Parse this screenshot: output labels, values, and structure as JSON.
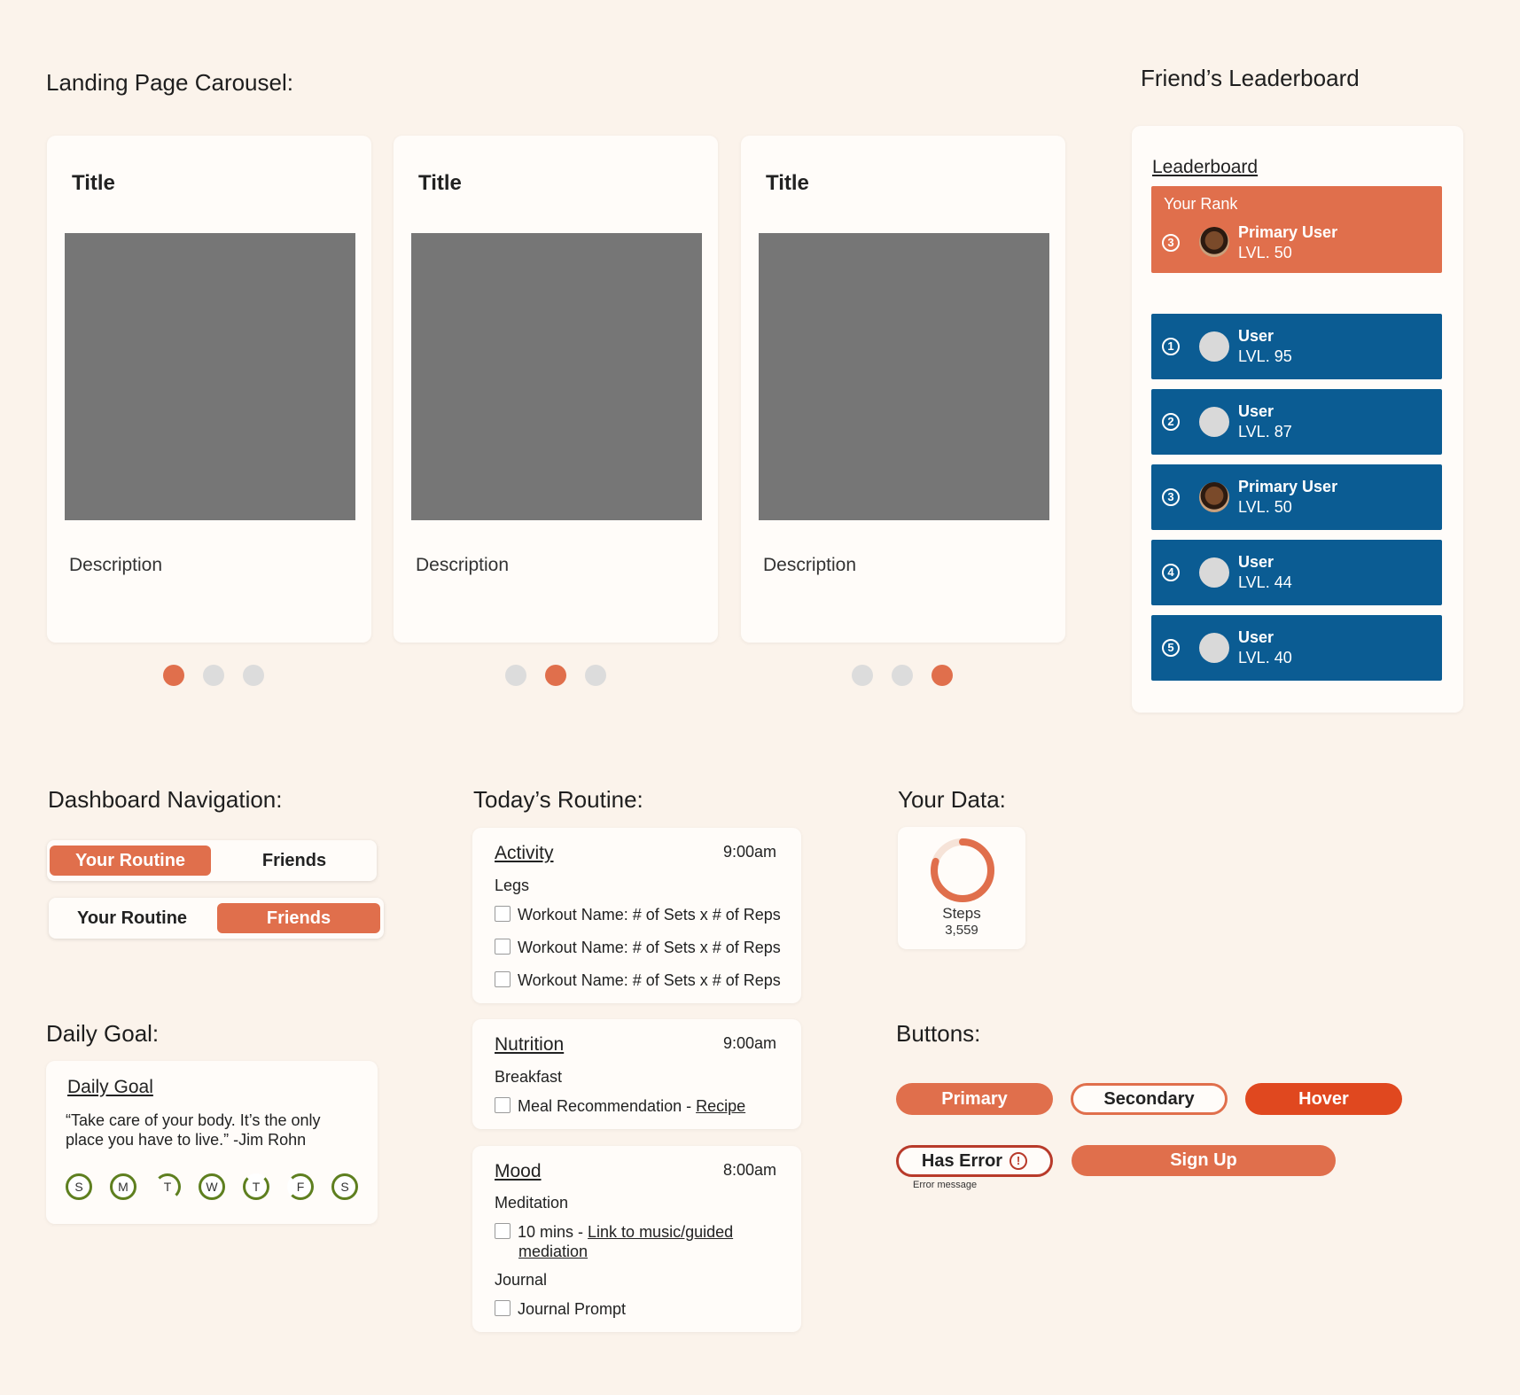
{
  "carousel": {
    "section_title": "Landing Page Carousel:",
    "cards": [
      {
        "title": "Title",
        "description": "Description"
      },
      {
        "title": "Title",
        "description": "Description"
      },
      {
        "title": "Title",
        "description": "Description"
      }
    ]
  },
  "leaderboard": {
    "section_title": "Friend’s Leaderboard",
    "heading": "Leaderboard",
    "your_rank": {
      "label": "Your Rank",
      "rank": "3",
      "name": "Primary User",
      "level": "LVL. 50"
    },
    "rows": [
      {
        "rank": "1",
        "name": "User",
        "level": "LVL. 95"
      },
      {
        "rank": "2",
        "name": "User",
        "level": "LVL. 87"
      },
      {
        "rank": "3",
        "name": "Primary User",
        "level": "LVL. 50"
      },
      {
        "rank": "4",
        "name": "User",
        "level": "LVL. 44"
      },
      {
        "rank": "5",
        "name": "User",
        "level": "LVL. 40"
      }
    ]
  },
  "dashboard_nav": {
    "section_title": "Dashboard Navigation:",
    "tab_routine": "Your Routine",
    "tab_friends": "Friends"
  },
  "routine": {
    "section_title": "Today’s Routine:",
    "activity": {
      "title": "Activity",
      "time": "9:00am",
      "group": "Legs",
      "items": [
        "Workout Name: # of Sets x # of Reps",
        "Workout Name: # of Sets x # of Reps",
        "Workout Name: # of Sets x # of Reps"
      ]
    },
    "nutrition": {
      "title": "Nutrition",
      "time": "9:00am",
      "group": "Breakfast",
      "item": "Meal Recommendation - ",
      "link": "Recipe"
    },
    "mood": {
      "title": "Mood",
      "time": "8:00am",
      "group1": "Meditation",
      "item1": "10 mins - ",
      "link1a": "Link to music/guided",
      "link1b": "mediation",
      "group2": "Journal",
      "item2": "Journal Prompt"
    }
  },
  "your_data": {
    "section_title": "Your Data:",
    "label": "Steps",
    "value": "3,559",
    "progress": 0.8,
    "accent": "#E06F4C"
  },
  "daily_goal": {
    "section_title": "Daily Goal:",
    "heading": "Daily Goal",
    "quote_line1": "“Take care of your body. It’s the only",
    "quote_line2": "place you have to live.” -Jim Rohn",
    "days": [
      "S",
      "M",
      "T",
      "W",
      "T",
      "F",
      "S"
    ]
  },
  "buttons": {
    "section_title": "Buttons:",
    "primary": "Primary",
    "secondary": "Secondary",
    "hover": "Hover",
    "error": "Has Error",
    "error_message": "Error message",
    "signup": "Sign Up"
  },
  "colors": {
    "accent": "#E06F4C",
    "hover": "#E0481F",
    "leaderboard_row": "#0B5C93",
    "goal_ring": "#5E7F1F",
    "error": "#B83A2A"
  }
}
